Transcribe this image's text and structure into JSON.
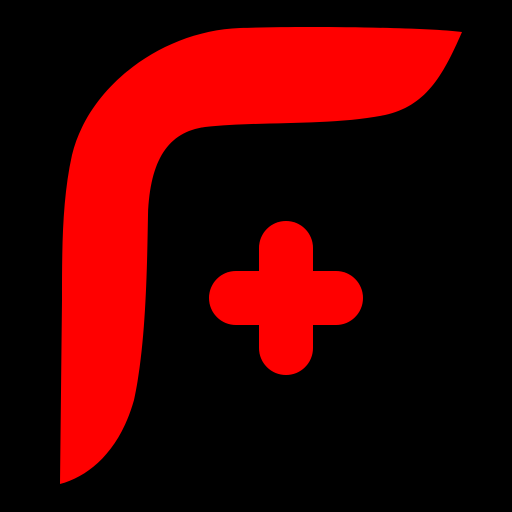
{
  "icon": {
    "name": "f-plus-logo-icon",
    "background_color": "#000000",
    "accent_color": "#FF0000"
  }
}
